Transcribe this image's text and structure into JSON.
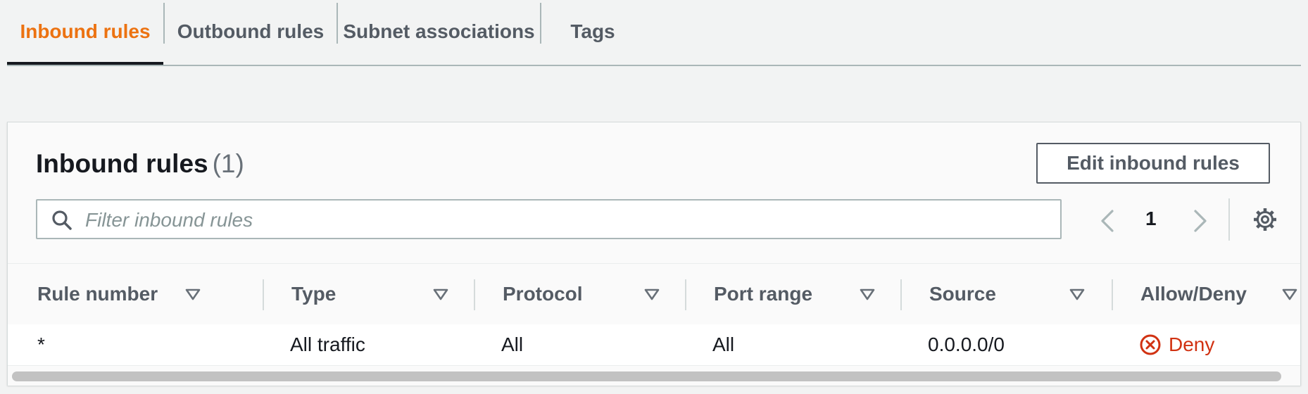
{
  "tabs": [
    {
      "label": "Inbound rules",
      "active": true
    },
    {
      "label": "Outbound rules",
      "active": false
    },
    {
      "label": "Subnet associations",
      "active": false
    },
    {
      "label": "Tags",
      "active": false
    }
  ],
  "panel": {
    "title": "Inbound rules",
    "count": "(1)",
    "edit_button": "Edit inbound rules",
    "search_placeholder": "Filter inbound rules",
    "page_number": "1"
  },
  "table": {
    "columns": [
      "Rule number",
      "Type",
      "Protocol",
      "Port range",
      "Source",
      "Allow/Deny"
    ],
    "rows": [
      {
        "rule_number": "*",
        "type": "All traffic",
        "protocol": "All",
        "port_range": "All",
        "source": "0.0.0.0/0",
        "allow_deny": "Deny"
      }
    ]
  },
  "colors": {
    "active_tab": "#ec7211",
    "deny": "#d13212",
    "text": "#16191f",
    "muted": "#545b64"
  },
  "icons": [
    "search-icon",
    "chevron-left-icon",
    "chevron-right-icon",
    "gear-icon",
    "sort-caret-icon",
    "deny-x-circle-icon"
  ]
}
